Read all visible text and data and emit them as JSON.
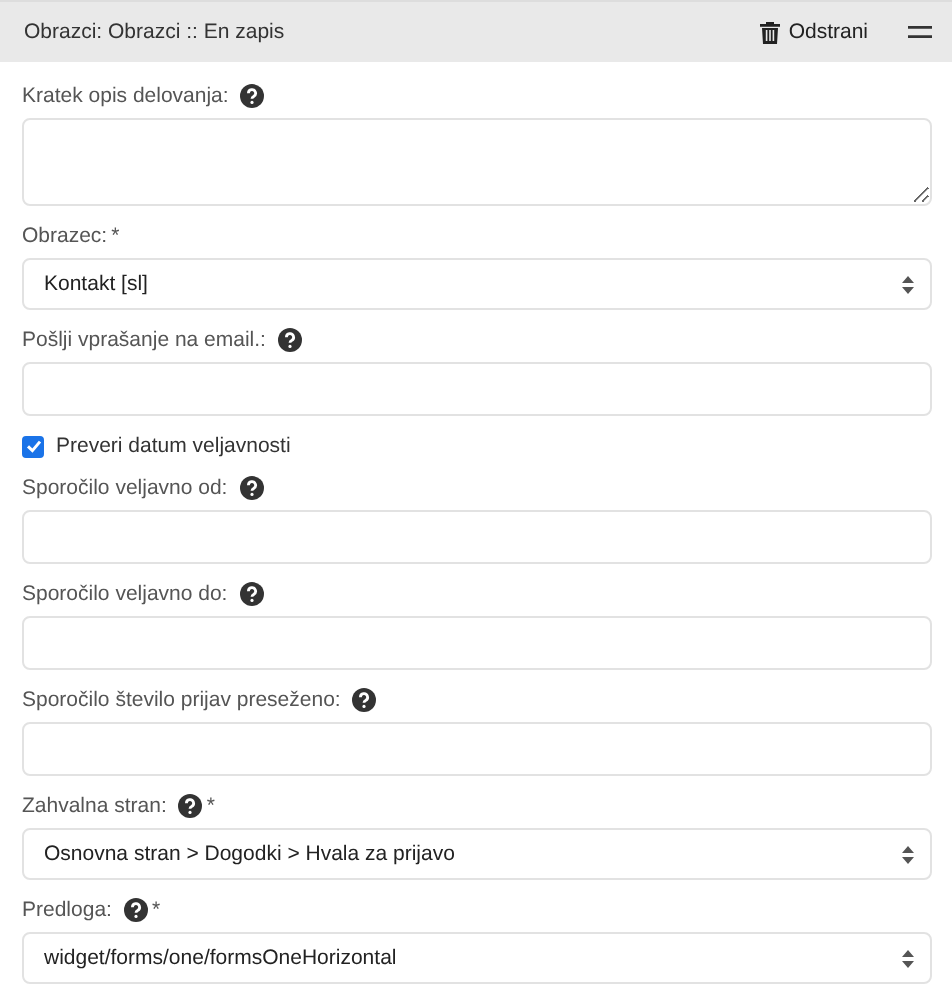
{
  "header": {
    "title": "Obrazci: Obrazci :: En zapis",
    "remove_label": "Odstrani"
  },
  "fields": [
    {
      "kind": "textarea",
      "label": "Kratek opis delovanja:",
      "help": true
    },
    {
      "kind": "select",
      "label": "Obrazec:",
      "help": false,
      "required_mark": "*",
      "value": "Kontakt [sl]"
    },
    {
      "kind": "input",
      "label": "Pošlji vprašanje na email.:",
      "help": true
    },
    {
      "kind": "checkbox",
      "label": "Preveri datum veljavnosti",
      "checked": true
    },
    {
      "kind": "input",
      "label": "Sporočilo veljavno od:",
      "help": true
    },
    {
      "kind": "input",
      "label": "Sporočilo veljavno do:",
      "help": true
    },
    {
      "kind": "input",
      "label": "Sporočilo število prijav preseženo:",
      "help": true
    },
    {
      "kind": "select",
      "label": "Zahvalna stran:",
      "help": true,
      "required_mark": "*",
      "value": "Osnovna stran > Dogodki > Hvala za prijavo"
    },
    {
      "kind": "select",
      "label": "Predloga:",
      "help": true,
      "required_mark": "*",
      "value": "widget/forms/one/formsOneHorizontal"
    }
  ]
}
